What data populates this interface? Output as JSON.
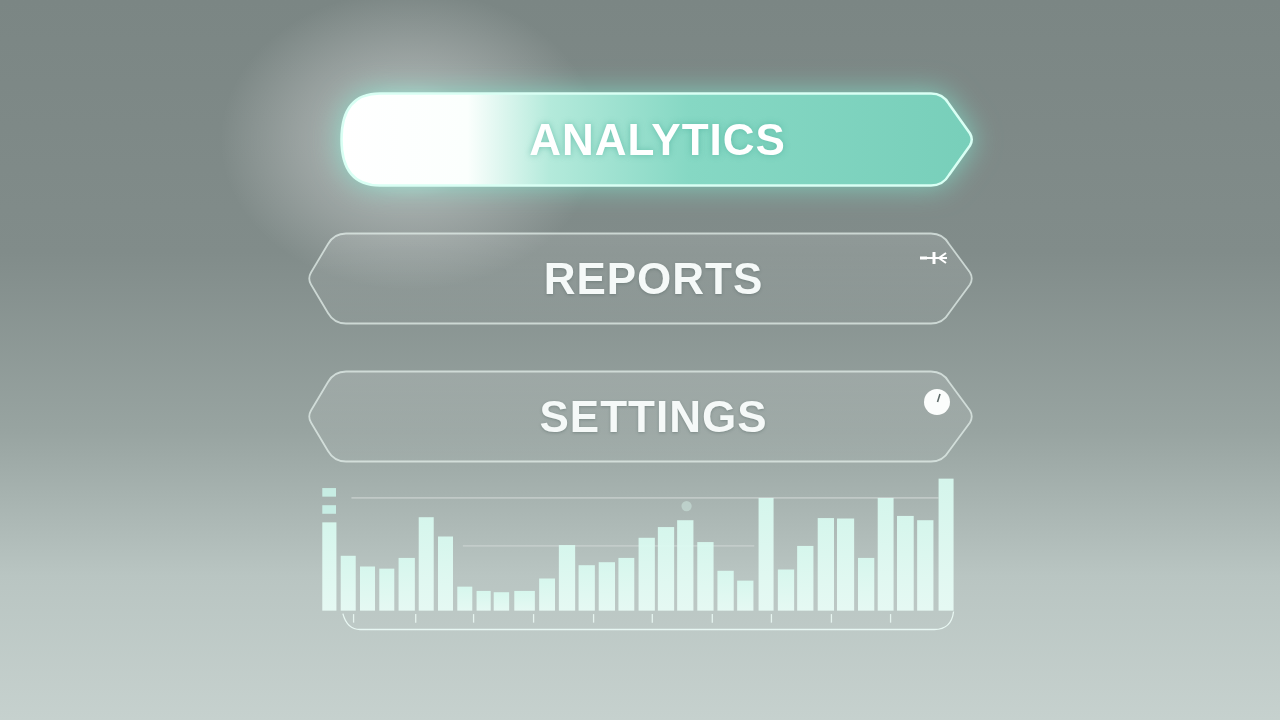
{
  "menu": [
    {
      "label": "ANALYTICS",
      "selected": true
    },
    {
      "label": "REPORTS",
      "selected": false
    },
    {
      "label": "SETTINGS",
      "selected": false
    }
  ]
}
